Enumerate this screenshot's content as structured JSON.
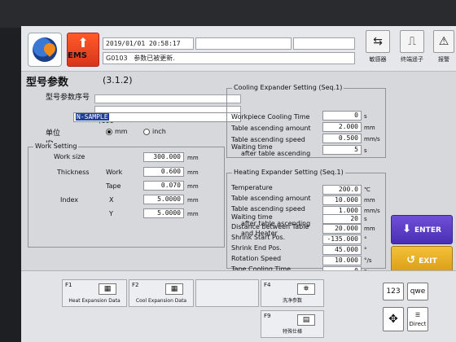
{
  "header": {
    "ems_label": "EMS",
    "timestamp": "2019/01/01 20:58:17",
    "message_code": "G0103",
    "message_text": "参数已被更新.",
    "buttons": [
      {
        "label": "敏感器",
        "icon": "sensor-icon"
      },
      {
        "label": "终端遥子",
        "icon": "terminal-icon"
      },
      {
        "label": "报警",
        "icon": "alarm-icon"
      }
    ]
  },
  "page": {
    "title": "型号参数",
    "code": "(3.1.2)"
  },
  "model": {
    "seq_label": "型号参数序号",
    "count": "/999",
    "id_label": "ID",
    "id_value": "N-SAMPLE",
    "unit_label": "单位",
    "unit_options": [
      "mm",
      "inch"
    ],
    "unit_selected": "mm"
  },
  "work_setting": {
    "group_label": "Work Setting",
    "work_size_label": "Work size",
    "work_size": "300.000",
    "thickness_label": "Thickness",
    "work_label": "Work",
    "work_thickness": "0.600",
    "tape_label": "Tape",
    "tape_thickness": "0.070",
    "index_label": "Index",
    "x_label": "X",
    "x_value": "5.0000",
    "y_label": "Y",
    "y_value": "5.0000",
    "unit": "mm"
  },
  "cooling": {
    "title": "Cooling Expander Setting (Seq.1)",
    "rows": [
      {
        "label": "Workpiece Cooling Time",
        "value": "0",
        "unit": "s"
      },
      {
        "label": "Table ascending amount",
        "value": "2.000",
        "unit": "mm"
      },
      {
        "label": "Table ascending speed",
        "value": "0.500",
        "unit": "mm/s"
      },
      {
        "label": "Waiting time",
        "label2": "after table ascending",
        "value": "5",
        "unit": "s"
      }
    ]
  },
  "heating": {
    "title": "Heating Expander Setting (Seq.1)",
    "rows": [
      {
        "label": "Temperature",
        "value": "200.0",
        "unit": "℃"
      },
      {
        "label": "Table ascending amount",
        "value": "10.000",
        "unit": "mm"
      },
      {
        "label": "Table ascending speed",
        "value": "1.000",
        "unit": "mm/s"
      },
      {
        "label": "Waiting time",
        "label2": "after table ascending",
        "value": "20",
        "unit": "s"
      },
      {
        "label": "Distance between Table",
        "label2": "and Heater",
        "value": "20.000",
        "unit": "mm"
      },
      {
        "label": "Shrink Start Pos.",
        "value": "-135.000",
        "unit": "°"
      },
      {
        "label": "Shrink End Pos.",
        "value": "45.000",
        "unit": "°"
      },
      {
        "label": "Rotation Speed",
        "value": "10.000",
        "unit": "°/s"
      },
      {
        "label": "Tape Cooling Time",
        "value": "0",
        "unit": "s"
      }
    ]
  },
  "side": {
    "enter": "ENTER",
    "exit": "EXIT"
  },
  "fkeys": {
    "f1": {
      "key": "F1",
      "label": "Heat Expansion Data"
    },
    "f2": {
      "key": "F2",
      "label": "Cool Expansion Data"
    },
    "f4": {
      "key": "F4",
      "label": "洗净参数"
    },
    "f9": {
      "key": "F9",
      "label": "特殊仕様"
    },
    "num": "123",
    "qwe": "qwe",
    "direct": "Direct"
  }
}
